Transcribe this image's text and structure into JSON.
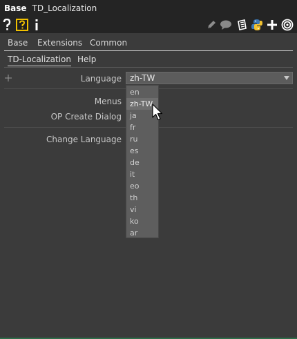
{
  "titlebar": {
    "op_type": "Base",
    "op_name": "TD_Localization"
  },
  "toolbar": {
    "left_icons": [
      "help-question-icon",
      "python-help-icon",
      "info-icon"
    ],
    "right_icons": [
      "pencil-edit-icon",
      "comment-bubble-icon",
      "clipboard-icon",
      "python-icon",
      "plus-icon",
      "target-icon"
    ]
  },
  "tabs_row1": [
    {
      "label": "Base"
    },
    {
      "label": "Extensions"
    },
    {
      "label": "Common"
    }
  ],
  "tabs_row2": [
    {
      "label": "TD-Localization"
    },
    {
      "label": "Help"
    }
  ],
  "params": {
    "language_label": "Language",
    "language_value": "zh-TW",
    "menus_label": "Menus",
    "op_create_dialog_label": "OP Create Dialog",
    "change_language_label": "Change Language"
  },
  "dropdown": {
    "options": [
      "en",
      "zh-TW",
      "ja",
      "fr",
      "ru",
      "es",
      "de",
      "it",
      "eo",
      "th",
      "vi",
      "ko",
      "ar"
    ],
    "highlighted": "zh-TW"
  },
  "colors": {
    "background": "#3b3b3b",
    "header": "#242424",
    "select": "#5c5c5c",
    "dropdown": "#5e5e5e",
    "python_blue": "#3c78b5",
    "python_yellow": "#f2c230",
    "help_yellow": "#f0c000"
  }
}
